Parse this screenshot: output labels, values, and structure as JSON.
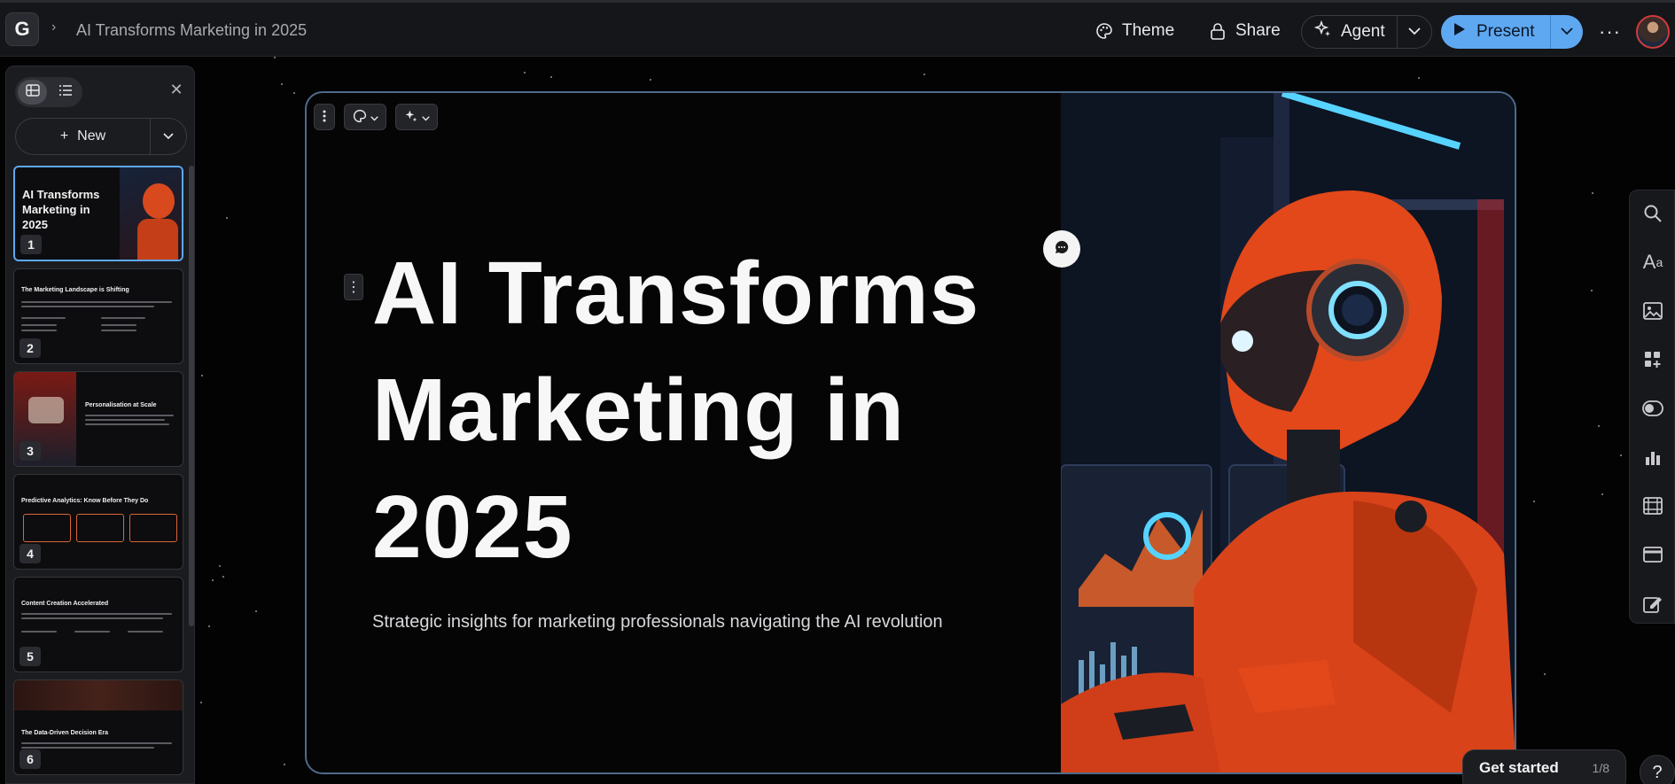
{
  "app": {
    "logo_letter": "G",
    "doc_title": "AI Transforms Marketing in 2025"
  },
  "toolbar": {
    "theme_label": "Theme",
    "share_label": "Share",
    "agent_label": "Agent",
    "present_label": "Present",
    "accent_color": "#5ea8f2"
  },
  "sidebar": {
    "new_label": "New",
    "slides": [
      {
        "num": "1",
        "title": "AI Transforms Marketing in 2025"
      },
      {
        "num": "2",
        "title": "The Marketing Landscape is Shifting"
      },
      {
        "num": "3",
        "title": "Personalisation at Scale"
      },
      {
        "num": "4",
        "title": "Predictive Analytics: Know Before They Do"
      },
      {
        "num": "5",
        "title": "Content Creation Accelerated"
      },
      {
        "num": "6",
        "title": "The Data-Driven Decision Era"
      }
    ]
  },
  "slide": {
    "title": "AI Transforms Marketing in 2025",
    "subtitle": "Strategic insights for marketing professionals navigating the AI revolution"
  },
  "onboarding": {
    "label": "Get started",
    "progress_text": "1/8",
    "progress_fraction": 0.125
  }
}
